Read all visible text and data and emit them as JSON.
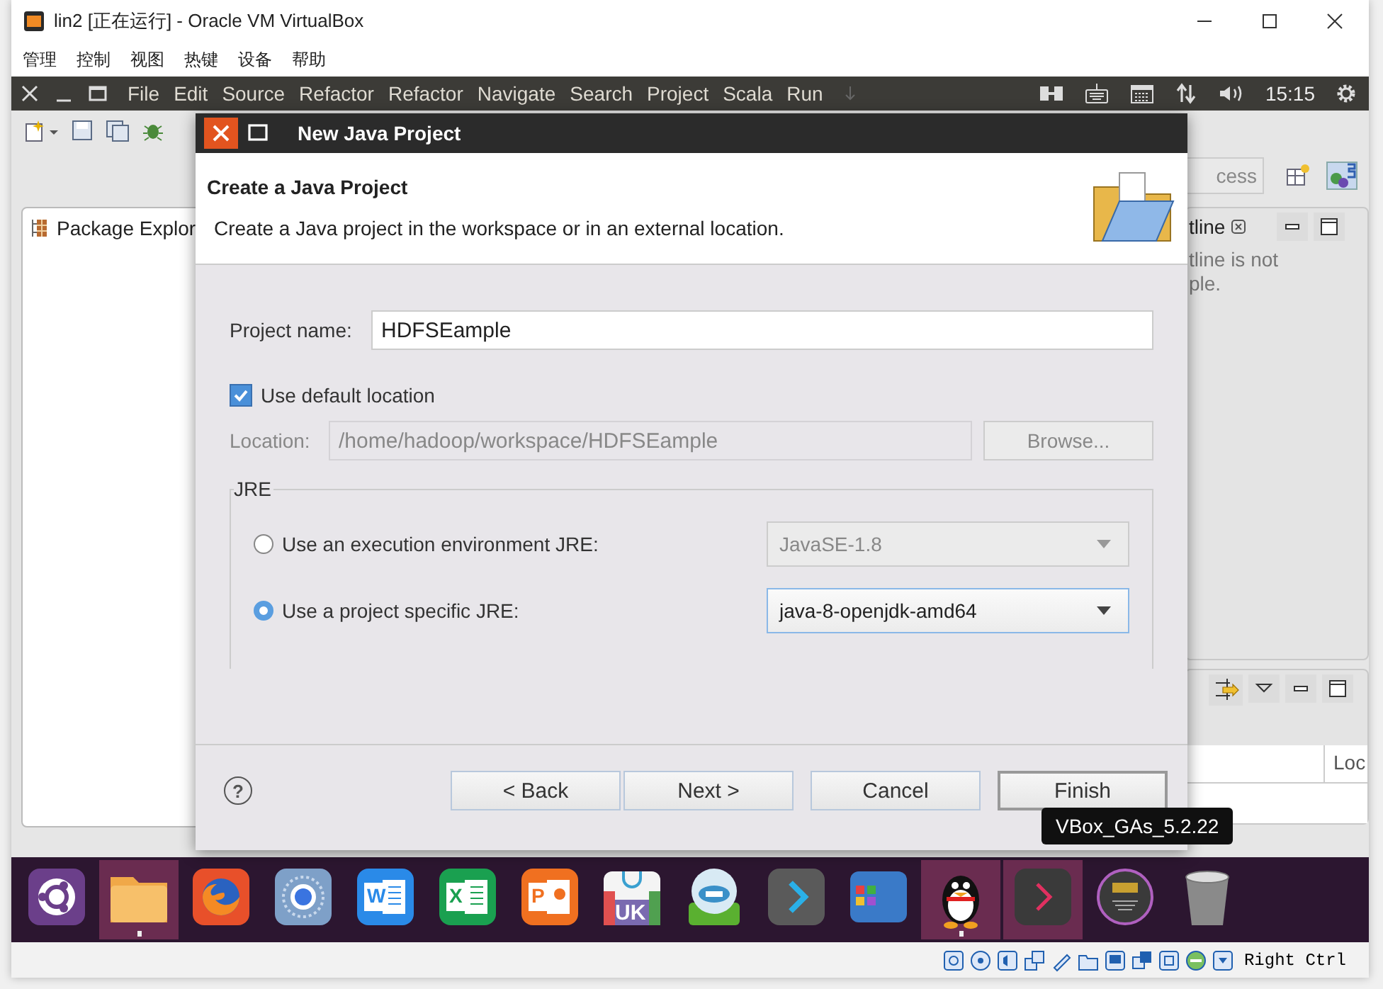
{
  "host_window": {
    "title": "lin2 [正在运行] - Oracle VM VirtualBox",
    "menu": [
      "管理",
      "控制",
      "视图",
      "热键",
      "设备",
      "帮助"
    ]
  },
  "guest_top_bar": {
    "menu": [
      "File",
      "Edit",
      "Source",
      "Refactor",
      "Refactor",
      "Navigate",
      "Search",
      "Project",
      "Scala",
      "Run"
    ],
    "clock": "15:15"
  },
  "eclipse": {
    "quick_access": "cess",
    "package_explorer": {
      "title": "Package Explor"
    },
    "outline": {
      "title": "tline",
      "message": "tline is not\nple."
    },
    "bottom_panel": {
      "column": "Loc"
    }
  },
  "dialog": {
    "title": "New Java Project",
    "header_title": "Create a Java Project",
    "header_description": "Create a Java project in the workspace or in an external location.",
    "project_name": {
      "label": "Project name:",
      "value": "HDFSEample"
    },
    "default_location": {
      "label": "Use default location",
      "checked": true
    },
    "location": {
      "label": "Location:",
      "value": "/home/hadoop/workspace/HDFSEample",
      "disabled": true
    },
    "browse": {
      "label": "Browse...",
      "disabled": true
    },
    "jre": {
      "title": "JRE",
      "options": [
        {
          "label": "Use an execution environment JRE:",
          "selected": false,
          "dropdown": "JavaSE-1.8"
        },
        {
          "label": "Use a project specific JRE:",
          "selected": true,
          "dropdown": "java-8-openjdk-amd64"
        }
      ]
    },
    "help": "?",
    "buttons": [
      {
        "label": "< Back",
        "kind": "normal"
      },
      {
        "label": "Next >",
        "kind": "normal"
      },
      {
        "label": "Cancel",
        "kind": "normal"
      },
      {
        "label": "Finish",
        "kind": "default"
      }
    ]
  },
  "launcher": {
    "items": [
      {
        "kind": "ubuntu",
        "running": false,
        "selected": false
      },
      {
        "kind": "files",
        "running": true,
        "selected": true
      },
      {
        "kind": "firefox",
        "running": false,
        "selected": false
      },
      {
        "kind": "chromium",
        "running": false,
        "selected": false
      },
      {
        "kind": "word",
        "label": "W",
        "running": false,
        "selected": false
      },
      {
        "kind": "excel",
        "label": "X",
        "running": false,
        "selected": false
      },
      {
        "kind": "powerpoint",
        "label": "P",
        "running": false,
        "selected": false
      },
      {
        "kind": "store",
        "label": "UK",
        "running": false,
        "selected": false
      },
      {
        "kind": "client",
        "running": false,
        "selected": false
      },
      {
        "kind": "chevron",
        "running": false,
        "selected": false
      },
      {
        "kind": "apps",
        "running": false,
        "selected": false
      },
      {
        "kind": "penguin",
        "running": true,
        "selected": true
      },
      {
        "kind": "terminal",
        "running": false,
        "selected": true
      },
      {
        "kind": "disc",
        "running": false,
        "selected": false
      },
      {
        "kind": "trash",
        "running": false,
        "selected": false
      }
    ]
  },
  "tooltip": "VBox_GAs_5.2.22",
  "status_bar": {
    "host_key": "Right Ctrl"
  }
}
